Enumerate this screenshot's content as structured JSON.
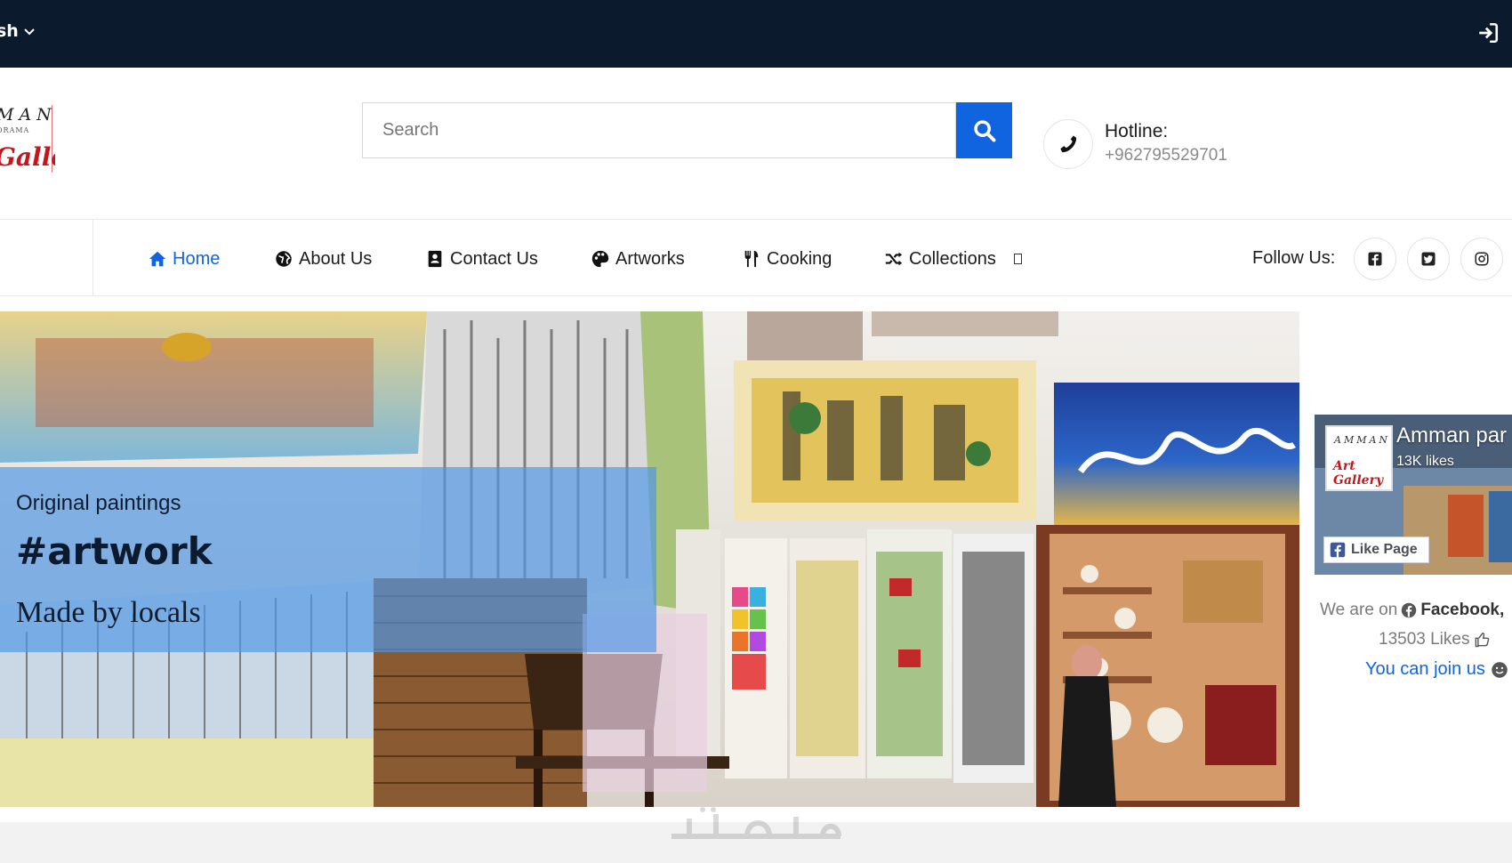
{
  "topbar": {
    "language": "sh"
  },
  "logo": {
    "line1": "MAN",
    "line2": "ORAMA",
    "line3": "Gallery"
  },
  "search": {
    "placeholder": "Search"
  },
  "hotline": {
    "label": "Hotline:",
    "number": "+962795529701"
  },
  "nav": {
    "items": [
      {
        "label": "Home",
        "icon": "home-icon",
        "active": true
      },
      {
        "label": "About Us",
        "icon": "globe-icon"
      },
      {
        "label": "Contact Us",
        "icon": "contact-card-icon"
      },
      {
        "label": "Artworks",
        "icon": "palette-icon"
      },
      {
        "label": "Cooking",
        "icon": "utensils-icon"
      },
      {
        "label": "Collections",
        "icon": "shuffle-icon"
      }
    ],
    "follow_label": "Follow Us:",
    "social": [
      "facebook-icon",
      "twitter-icon",
      "instagram-icon"
    ]
  },
  "hero": {
    "caption_small": "Original paintings",
    "caption_big": "#artwork",
    "caption_serif": "Made by locals"
  },
  "facebook_widget": {
    "page_name": "Amman par",
    "likes_short": "13K likes",
    "like_button": "Like Page",
    "logo_line1": "AMMAN",
    "logo_line2": "Art Gallery",
    "text_prefix": "We are on",
    "text_brand": "Facebook,",
    "likes_count": "13503 Likes",
    "join_text": "You can join us"
  },
  "colors": {
    "accent": "#1164e0",
    "topbar": "#0c1a2e"
  }
}
